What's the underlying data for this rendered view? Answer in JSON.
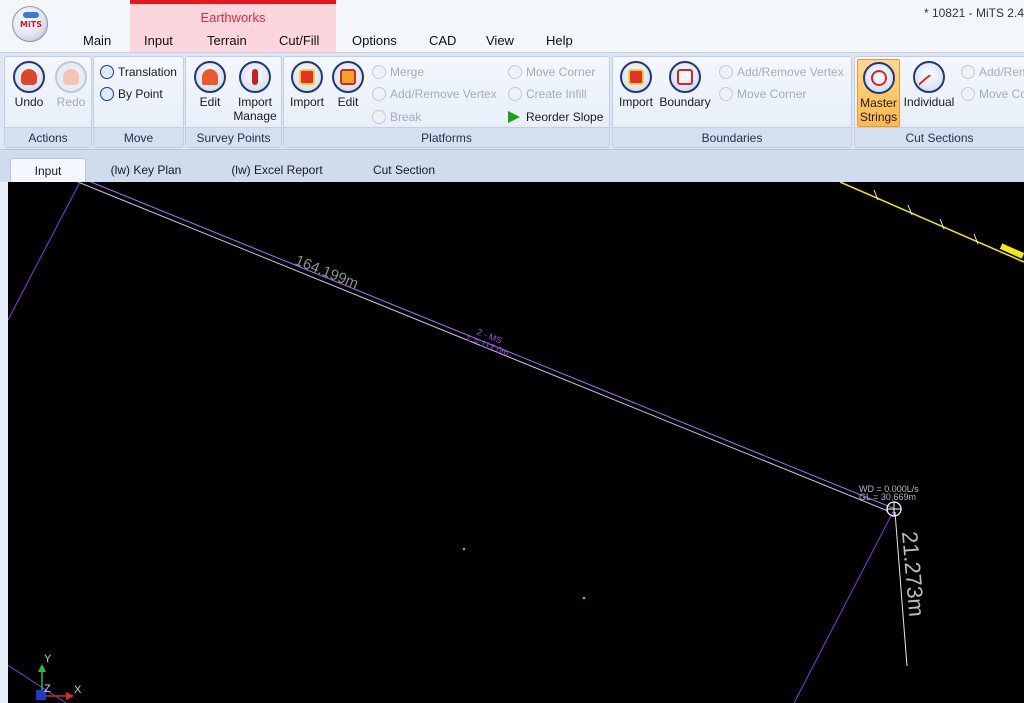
{
  "window": {
    "title": "* 10821 - MiTS 2.4"
  },
  "logo": {
    "text": "MiTS"
  },
  "menu": {
    "context_group": "Earthworks",
    "tabs": [
      "Main",
      "Input",
      "Terrain",
      "Cut/Fill",
      "Options",
      "CAD",
      "View",
      "Help"
    ]
  },
  "ribbon": {
    "actions": {
      "label": "Actions",
      "undo": "Undo",
      "redo": "Redo"
    },
    "move": {
      "label": "Move",
      "translation": "Translation",
      "by_point": "By Point"
    },
    "survey_points": {
      "label": "Survey Points",
      "edit": "Edit",
      "import_manage_1": "Import",
      "import_manage_2": "Manage"
    },
    "platforms": {
      "label": "Platforms",
      "import": "Import",
      "edit": "Edit",
      "merge": "Merge",
      "add_remove_vertex": "Add/Remove Vertex",
      "break": "Break",
      "move_corner": "Move Corner",
      "create_infill": "Create Infill",
      "reorder_slope": "Reorder Slope"
    },
    "boundaries": {
      "label": "Boundaries",
      "import": "Import",
      "boundary": "Boundary",
      "add_remove_vertex": "Add/Remove Vertex",
      "move_corner": "Move Corner"
    },
    "cut_sections": {
      "label": "Cut Sections",
      "master_1": "Master",
      "master_2": "Strings",
      "individual": "Individual",
      "add_remove": "Add/Rem",
      "move_corner": "Move Co"
    }
  },
  "doc_tabs": [
    "Input",
    "(lw) Key Plan",
    "(lw) Excel Report",
    "Cut Section"
  ],
  "cad": {
    "line_length": "164.199m",
    "string_id": "2 - MS",
    "string_length": "L = 117.0m",
    "wd": "WD = 0.000L/s",
    "gl": "GL = 30.669m",
    "drop_length": "21.273m",
    "axis_y": "Y",
    "axis_z": "Z",
    "axis_x": "X"
  },
  "colors": {
    "accent": "#e6171e",
    "context": "#fbd6dc",
    "purple": "#7a2fd6",
    "yellow": "#f2ea12",
    "background": "#000000"
  }
}
